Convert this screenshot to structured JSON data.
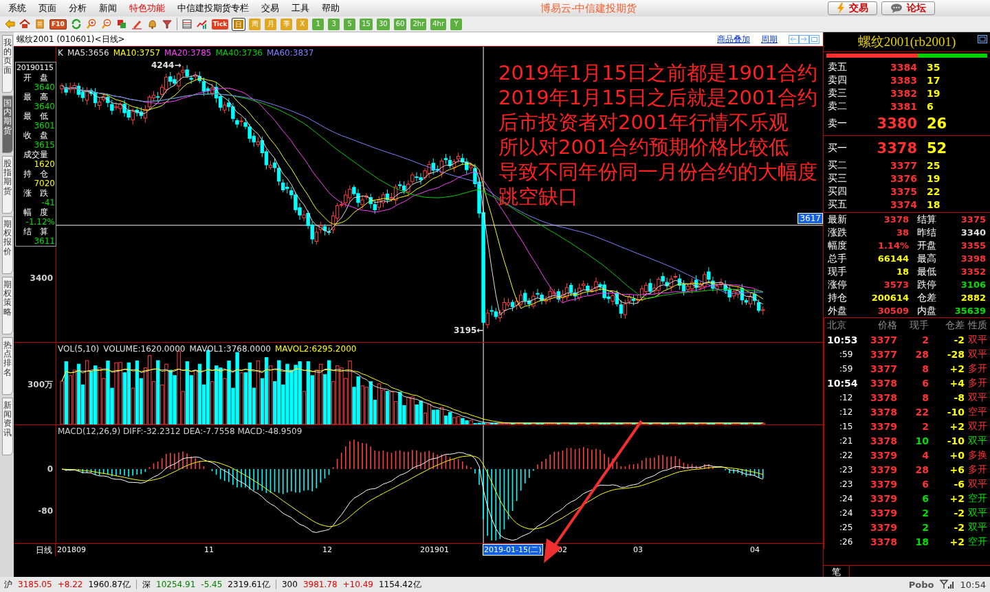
{
  "menu_bar": {
    "items": [
      {
        "label": "系统",
        "highlighted": false
      },
      {
        "label": "页面",
        "highlighted": false
      },
      {
        "label": "分析",
        "highlighted": false
      },
      {
        "label": "新闻",
        "highlighted": false
      },
      {
        "label": "特色功能",
        "highlighted": true
      },
      {
        "label": "中信建投期货专栏",
        "highlighted": false
      },
      {
        "label": "交易",
        "highlighted": false
      },
      {
        "label": "工具",
        "highlighted": false
      },
      {
        "label": "帮助",
        "highlighted": false
      }
    ],
    "title": "博易云-中信建投期货",
    "buttons": [
      "交易",
      "论坛"
    ]
  },
  "toolbar": {
    "f10_label": "F10",
    "tick_label": "Tick",
    "periods": [
      {
        "label": "日",
        "kind": "calendar",
        "selected": true
      },
      {
        "label": "周",
        "kind": "calendar",
        "selected": false
      },
      {
        "label": "月",
        "kind": "calendar",
        "selected": false
      },
      {
        "label": "季",
        "kind": "calendar",
        "selected": false
      },
      {
        "label": "X",
        "kind": "calendar",
        "selected": false
      },
      {
        "label": "1",
        "kind": "intraday",
        "selected": false
      },
      {
        "label": "3",
        "kind": "intraday",
        "selected": false
      },
      {
        "label": "5",
        "kind": "intraday",
        "selected": false
      },
      {
        "label": "15",
        "kind": "intraday",
        "selected": false
      },
      {
        "label": "30",
        "kind": "intraday",
        "selected": false
      },
      {
        "label": "60",
        "kind": "intraday",
        "selected": false
      },
      {
        "label": "2hr",
        "kind": "intraday",
        "selected": false
      },
      {
        "label": "4hr",
        "kind": "intraday",
        "selected": false
      },
      {
        "label": "Y",
        "kind": "intraday",
        "selected": false
      }
    ]
  },
  "left_tabs": [
    {
      "label": "我的页面",
      "selected": false
    },
    {
      "label": "国内期货",
      "selected": true
    },
    {
      "label": "股指期货",
      "selected": false
    },
    {
      "label": "期权报价",
      "selected": false
    },
    {
      "label": "期权策略",
      "selected": false
    },
    {
      "label": "热点排名",
      "selected": false
    },
    {
      "label": "新闻资讯",
      "selected": false
    }
  ],
  "chart": {
    "header": "螺纹2001 (010601)<日线>",
    "links": [
      "商品叠加",
      "周期"
    ],
    "info_box": {
      "date": "20190115",
      "fields": [
        {
          "label": "开　盘",
          "value": "3640",
          "color": "#00e000"
        },
        {
          "label": "最　高",
          "value": "3640",
          "color": "#00e000"
        },
        {
          "label": "最　低",
          "value": "3601",
          "color": "#00e000"
        },
        {
          "label": "收　盘",
          "value": "3615",
          "color": "#00e000"
        },
        {
          "label": "成交量",
          "value": "1620",
          "color": "#ffff00"
        },
        {
          "label": "持　仓",
          "value": "7020",
          "color": "#ffff00"
        },
        {
          "label": "涨　跌",
          "value": "-41",
          "color": "#00e000"
        },
        {
          "label": "幅　度",
          "value": "-1.12%",
          "color": "#00e000"
        },
        {
          "label": "结　算",
          "value": "3611",
          "color": "#00e000"
        }
      ]
    },
    "legend": [
      {
        "label": "K",
        "color": "#e0e0e0"
      },
      {
        "label": "MA5:3656",
        "color": "#e0e0e0"
      },
      {
        "label": "MA10:3757",
        "color": "#ffff00"
      },
      {
        "label": "MA20:3785",
        "color": "#ff40ff"
      },
      {
        "label": "MA40:3736",
        "color": "#00d000"
      },
      {
        "label": "MA60:3837",
        "color": "#8080ff"
      }
    ],
    "annotation": [
      "2019年1月15日之前都是1901合约",
      "2019年1月15日之后就是2001合约",
      "后市投资者对2001年行情不乐观",
      "所以对2001合约预期价格比较低",
      "导致不同年份同一月份合约的大幅度",
      "跳空缺口"
    ],
    "high_label": "4244→",
    "low_label": "3195←",
    "price_axis": "3400",
    "crosshair_price": "3617",
    "volume": {
      "legend": [
        {
          "label": "VOL(5,10)",
          "color": "#e0e0e0"
        },
        {
          "label": "VOLUME:1620.0000",
          "color": "#e0e0e0"
        },
        {
          "label": "MAVOL1:3768.0000",
          "color": "#e0e0e0"
        },
        {
          "label": "MAVOL2:6295.2000",
          "color": "#ffff00"
        }
      ],
      "axis": "300万"
    },
    "macd": {
      "legend": "MACD(12,26,9) DIFF:-32.2312 DEA:-7.7558 MACD:-48.9509",
      "axis": [
        "0",
        "-80"
      ]
    },
    "x_axis": {
      "period": "日线",
      "labels": [
        {
          "label": "201809",
          "selected": false
        },
        {
          "label": "11",
          "selected": false
        },
        {
          "label": "12",
          "selected": false
        },
        {
          "label": "201901",
          "selected": false
        },
        {
          "label": "2019-01-15(二)",
          "selected": true
        },
        {
          "label": "02",
          "selected": false
        },
        {
          "label": "03",
          "selected": false
        },
        {
          "label": "04",
          "selected": false
        }
      ]
    }
  },
  "quote_panel": {
    "title": "螺纹2001(rb2001)",
    "buy_sell_bar": {
      "level": 0.57
    },
    "asks": [
      {
        "label": "卖五",
        "price": "3384",
        "volume": "35",
        "best": false
      },
      {
        "label": "卖四",
        "price": "3383",
        "volume": "17",
        "best": false
      },
      {
        "label": "卖三",
        "price": "3382",
        "volume": "19",
        "best": false
      },
      {
        "label": "卖二",
        "price": "3381",
        "volume": "6",
        "best": false
      },
      {
        "label": "卖一",
        "price": "3380",
        "volume": "26",
        "best": true
      }
    ],
    "bids": [
      {
        "label": "买一",
        "price": "3378",
        "volume": "52",
        "best": true
      },
      {
        "label": "买二",
        "price": "3377",
        "volume": "25",
        "best": false
      },
      {
        "label": "买三",
        "price": "3376",
        "volume": "19",
        "best": false
      },
      {
        "label": "买四",
        "price": "3375",
        "volume": "22",
        "best": false
      },
      {
        "label": "买五",
        "price": "3374",
        "volume": "18",
        "best": false
      }
    ],
    "stats": [
      {
        "label": "最新",
        "value": "3378",
        "color": "#ff3333"
      },
      {
        "label": "结算",
        "value": "3375",
        "color": "#ff3333"
      },
      {
        "label": "涨跌",
        "value": "38",
        "color": "#ff3333"
      },
      {
        "label": "昨结",
        "value": "3340",
        "color": "#e0e0e0"
      },
      {
        "label": "幅度",
        "value": "1.14%",
        "color": "#ff3333"
      },
      {
        "label": "开盘",
        "value": "3355",
        "color": "#ff3333"
      },
      {
        "label": "总手",
        "value": "66144",
        "color": "#ffff00"
      },
      {
        "label": "最高",
        "value": "3398",
        "color": "#ff3333"
      },
      {
        "label": "现手",
        "value": "18",
        "color": "#ffff00"
      },
      {
        "label": "最低",
        "value": "3352",
        "color": "#ff3333"
      },
      {
        "label": "涨停",
        "value": "3573",
        "color": "#ff3333"
      },
      {
        "label": "跌停",
        "value": "3106",
        "color": "#00e000"
      },
      {
        "label": "持仓",
        "value": "200614",
        "color": "#ffff00"
      },
      {
        "label": "仓差",
        "value": "2882",
        "color": "#ffff00"
      },
      {
        "label": "外盘",
        "value": "30509",
        "color": "#ff3333"
      },
      {
        "label": "内盘",
        "value": "35639",
        "color": "#00e000"
      }
    ],
    "ticks": {
      "columns": [
        "北京",
        "价格",
        "现手",
        "仓差",
        "性质"
      ],
      "rows": [
        {
          "time": "10:53",
          "kind": "minute",
          "price": "3377",
          "volume": "2",
          "change": "-2",
          "nature": "双平",
          "color": "#ff3333"
        },
        {
          "time": ":59",
          "kind": "second",
          "price": "3377",
          "volume": "28",
          "change": "-28",
          "nature": "双平",
          "color": "#ff3333"
        },
        {
          "time": ":59",
          "kind": "second",
          "price": "3377",
          "volume": "8",
          "change": "+2",
          "nature": "多开",
          "color": "#ff3333"
        },
        {
          "time": "10:54",
          "kind": "minute",
          "price": "3378",
          "volume": "6",
          "change": "+4",
          "nature": "多开",
          "color": "#ff3333"
        },
        {
          "time": ":12",
          "kind": "second",
          "price": "3378",
          "volume": "8",
          "change": "-8",
          "nature": "双平",
          "color": "#ff3333"
        },
        {
          "time": ":12",
          "kind": "second",
          "price": "3378",
          "volume": "22",
          "change": "-10",
          "nature": "空平",
          "color": "#ff3333"
        },
        {
          "time": ":15",
          "kind": "second",
          "price": "3379",
          "volume": "2",
          "change": "+2",
          "nature": "双开",
          "color": "#ff3333"
        },
        {
          "time": ":21",
          "kind": "second",
          "price": "3378",
          "volume": "10",
          "change": "-10",
          "nature": "双平",
          "color": "#00e000"
        },
        {
          "time": ":22",
          "kind": "second",
          "price": "3379",
          "volume": "4",
          "change": "+0",
          "nature": "多换",
          "color": "#ff3333"
        },
        {
          "time": ":23",
          "kind": "second",
          "price": "3379",
          "volume": "28",
          "change": "+6",
          "nature": "多开",
          "color": "#ff3333"
        },
        {
          "time": ":23",
          "kind": "second",
          "price": "3379",
          "volume": "6",
          "change": "-6",
          "nature": "双平",
          "color": "#ff3333"
        },
        {
          "time": ":24",
          "kind": "second",
          "price": "3379",
          "volume": "6",
          "change": "+2",
          "nature": "空开",
          "color": "#00e000"
        },
        {
          "time": ":24",
          "kind": "second",
          "price": "3379",
          "volume": "2",
          "change": "-2",
          "nature": "双平",
          "color": "#00e000"
        },
        {
          "time": ":25",
          "kind": "second",
          "price": "3379",
          "volume": "2",
          "change": "-2",
          "nature": "双平",
          "color": "#00e000"
        },
        {
          "time": ":26",
          "kind": "second",
          "price": "3378",
          "volume": "18",
          "change": "+2",
          "nature": "空开",
          "color": "#00e000"
        }
      ]
    },
    "tab": "笔"
  },
  "status_bar": {
    "indices": [
      {
        "name": "沪",
        "price": "3185.05",
        "change": "+8.22",
        "amount": "1960.87亿",
        "color": "#e00000"
      },
      {
        "name": "深",
        "price": "10254.91",
        "change": "-5.45",
        "amount": "2319.61亿",
        "color": "#008000"
      },
      {
        "name": "300",
        "price": "3981.78",
        "change": "+10.49",
        "amount": "1154.42亿",
        "color": "#e00000"
      }
    ],
    "brand": "Pobo",
    "time": "10:54"
  }
}
